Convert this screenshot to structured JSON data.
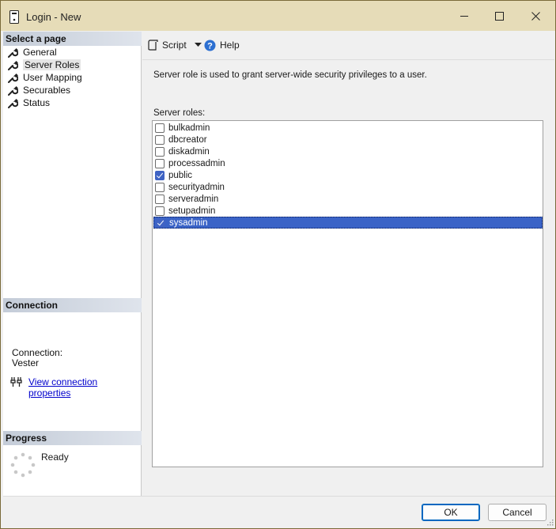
{
  "window": {
    "title": "Login - New",
    "title_bar_color": "#e6dcb8"
  },
  "left_pane": {
    "select_page_header": "Select a page",
    "pages": [
      {
        "label": "General",
        "icon": "wrench-icon"
      },
      {
        "label": "Server Roles",
        "icon": "wrench-icon",
        "selected": true
      },
      {
        "label": "User Mapping",
        "icon": "wrench-icon"
      },
      {
        "label": "Securables",
        "icon": "wrench-icon"
      },
      {
        "label": "Status",
        "icon": "wrench-icon"
      }
    ],
    "connection_header": "Connection",
    "connection_label": "Connection:",
    "connection_value": "Vester",
    "connection_link": "View connection properties",
    "progress_header": "Progress",
    "progress_status": "Ready"
  },
  "toolbar": {
    "script_label": "Script",
    "help_label": "Help"
  },
  "main": {
    "description": "Server role is used to grant server-wide security privileges to a user.",
    "roles_label": "Server roles:",
    "roles": [
      {
        "name": "bulkadmin",
        "checked": false
      },
      {
        "name": "dbcreator",
        "checked": false
      },
      {
        "name": "diskadmin",
        "checked": false
      },
      {
        "name": "processadmin",
        "checked": false
      },
      {
        "name": "public",
        "checked": true
      },
      {
        "name": "securityadmin",
        "checked": false
      },
      {
        "name": "serveradmin",
        "checked": false
      },
      {
        "name": "setupadmin",
        "checked": false
      },
      {
        "name": "sysadmin",
        "checked": true,
        "selected": true
      }
    ]
  },
  "buttons": {
    "ok_label": "OK",
    "cancel_label": "Cancel"
  },
  "colors": {
    "selection": "#3a63c7",
    "link": "#0000cc",
    "checkbox_checked": "#3f63c4"
  }
}
